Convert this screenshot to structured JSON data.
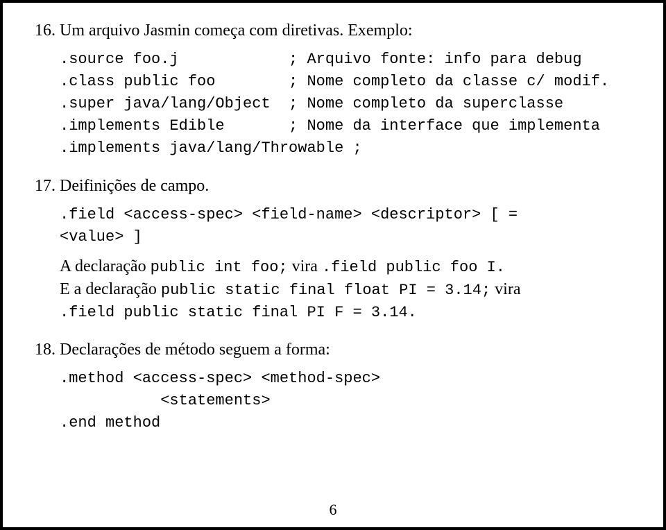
{
  "items": {
    "i16": {
      "num": "16.",
      "title": "Um arquivo Jasmin começa com diretivas. Exemplo:",
      "code": ".source foo.j            ; Arquivo fonte: info para debug\n.class public foo        ; Nome completo da classe c/ modif.\n.super java/lang/Object  ; Nome completo da superclasse\n.implements Edible       ; Nome da interface que implementa\n.implements java/lang/Throwable ;"
    },
    "i17": {
      "num": "17.",
      "title": "Deifinições de campo.",
      "code1": ".field <access-spec> <field-name> <descriptor> [ =\n<value> ]",
      "p1_a": "A declaração ",
      "p1_b": "public int foo;",
      "p1_c": " vira ",
      "p1_d": ".field public foo I.",
      "p2_a": "E a declaração ",
      "p2_b": "public static final float PI = 3.14;",
      "p2_c": " vira",
      "p3": ".field public static final PI F = 3.14.",
      "p3_trail": ""
    },
    "i18": {
      "num": "18.",
      "title": "Declarações de método seguem a forma:",
      "code": ".method <access-spec> <method-spec>\n           <statements>\n.end method"
    }
  },
  "pagenum": "6"
}
